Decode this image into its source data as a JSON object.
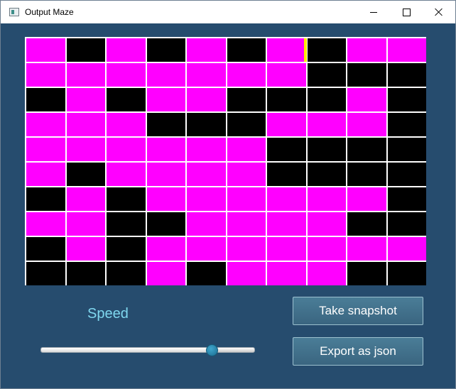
{
  "window": {
    "title": "Output Maze"
  },
  "colors": {
    "path": "#ff00ff",
    "wall": "#000000",
    "border": "#ffffff",
    "marker": "#ffea00",
    "background": "#264c6e",
    "speed_label": "#7fd7ef"
  },
  "maze": {
    "rows": 10,
    "cols": 10,
    "grid": [
      [
        1,
        0,
        1,
        0,
        1,
        0,
        1,
        0,
        1,
        1
      ],
      [
        1,
        1,
        1,
        1,
        1,
        1,
        1,
        0,
        0,
        0
      ],
      [
        0,
        1,
        0,
        1,
        1,
        0,
        0,
        0,
        1,
        0
      ],
      [
        1,
        1,
        1,
        0,
        0,
        0,
        1,
        1,
        1,
        0
      ],
      [
        1,
        1,
        1,
        1,
        1,
        1,
        0,
        0,
        0,
        0
      ],
      [
        1,
        0,
        1,
        1,
        1,
        1,
        0,
        0,
        0,
        0
      ],
      [
        0,
        1,
        0,
        1,
        1,
        1,
        1,
        1,
        1,
        0
      ],
      [
        1,
        1,
        0,
        0,
        1,
        1,
        1,
        1,
        0,
        0
      ],
      [
        0,
        1,
        0,
        1,
        1,
        1,
        1,
        1,
        1,
        1
      ],
      [
        0,
        0,
        0,
        1,
        0,
        1,
        1,
        1,
        0,
        0
      ]
    ],
    "marker": {
      "row": 0,
      "col": 6,
      "side": "right"
    }
  },
  "controls": {
    "speed_label": "Speed",
    "speed_value": 0.8,
    "snapshot_button": "Take snapshot",
    "export_button": "Export as json"
  }
}
